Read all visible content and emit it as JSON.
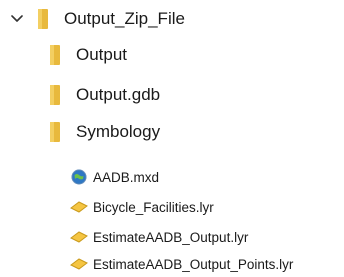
{
  "tree": {
    "root": {
      "label": "Output_Zip_File",
      "expanded": true,
      "icon": "folder-icon",
      "expander_icon": "chevron-down-icon"
    },
    "folders": [
      {
        "label": "Output",
        "icon": "folder-icon"
      },
      {
        "label": "Output.gdb",
        "icon": "folder-icon"
      },
      {
        "label": "Symbology",
        "icon": "folder-icon"
      }
    ],
    "files": [
      {
        "label": "AADB.mxd",
        "icon": "map-document-icon"
      },
      {
        "label": "Bicycle_Facilities.lyr",
        "icon": "layer-file-icon"
      },
      {
        "label": "EstimateAADB_Output.lyr",
        "icon": "layer-file-icon"
      },
      {
        "label": "EstimateAADB_Output_Points.lyr",
        "icon": "layer-file-icon"
      }
    ]
  },
  "colors": {
    "folder": "#e8b93d",
    "layer_file": "#f5c542",
    "map_globe": "#2f78c4",
    "text": "#1a1a1a"
  }
}
